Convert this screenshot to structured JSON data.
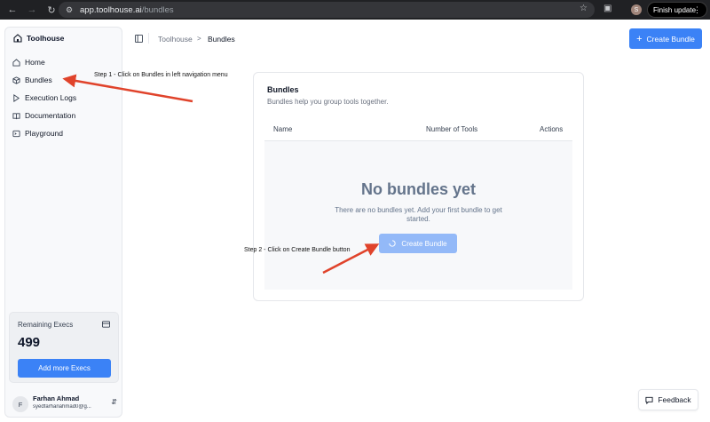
{
  "browser": {
    "url_host": "app.toolhouse.ai",
    "url_path": "/bundles",
    "profile_initial": "S",
    "finish_update_label": "Finish update"
  },
  "sidebar": {
    "brand": "Toolhouse",
    "items": [
      {
        "label": "Home",
        "icon": "home-icon"
      },
      {
        "label": "Bundles",
        "icon": "box-icon"
      },
      {
        "label": "Execution Logs",
        "icon": "play-icon"
      },
      {
        "label": "Documentation",
        "icon": "book-icon"
      },
      {
        "label": "Playground",
        "icon": "terminal-icon"
      }
    ],
    "execs": {
      "label": "Remaining Execs",
      "value": "499",
      "button_label": "Add more Execs"
    },
    "user": {
      "initial": "F",
      "name": "Farhan Ahmad",
      "email": "syedfarhanahmad0@g..."
    }
  },
  "header": {
    "breadcrumb_root": "Toolhouse",
    "breadcrumb_sep": ">",
    "breadcrumb_current": "Bundles",
    "create_button_label": "Create Bundle"
  },
  "panel": {
    "title": "Bundles",
    "description": "Bundles help you group tools together.",
    "columns": [
      "Name",
      "Number of Tools",
      "Actions"
    ],
    "empty_title": "No bundles yet",
    "empty_text": "There are no bundles yet. Add your first bundle to get started.",
    "empty_button_label": "Create Bundle"
  },
  "annotations": {
    "step1": "Step 1 - Click on Bundles in left navigation menu",
    "step2": "Step 2 - Click on Create Bundle button",
    "arrow_color": "#e0432b"
  },
  "feedback_label": "Feedback",
  "colors": {
    "accent": "#3b82f6",
    "accent_disabled": "#93b9f8"
  }
}
